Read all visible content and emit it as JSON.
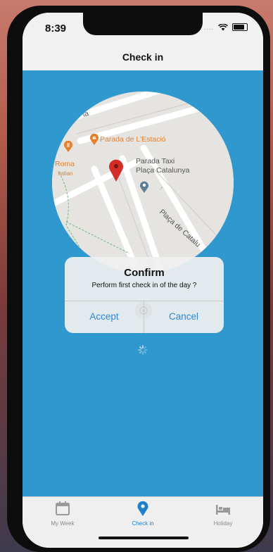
{
  "status": {
    "time": "8:39"
  },
  "nav": {
    "title": "Check in"
  },
  "map": {
    "labels": {
      "parada_estacio": "Parada de L'Estació",
      "roma": "Roma",
      "roma_sub": "Italian",
      "taxi_line1": "Parada Taxi",
      "taxi_line2": "Plaça Catalunya",
      "street": "Plaça de Catalu",
      "corner": "ia"
    }
  },
  "dialog": {
    "title": "Confirm",
    "message": "Perform first check in of the day ?",
    "accept": "Accept",
    "cancel": "Cancel"
  },
  "tabs": [
    {
      "label": "My Week",
      "icon": "calendar-icon",
      "active": false
    },
    {
      "label": "Check in",
      "icon": "location-pin-icon",
      "active": true
    },
    {
      "label": "Holiday",
      "icon": "bed-icon",
      "active": false
    }
  ],
  "colors": {
    "primary": "#2f98cf",
    "accent": "#2e86d6",
    "pin_red": "#d42d27",
    "map_orange": "#e3812e"
  }
}
